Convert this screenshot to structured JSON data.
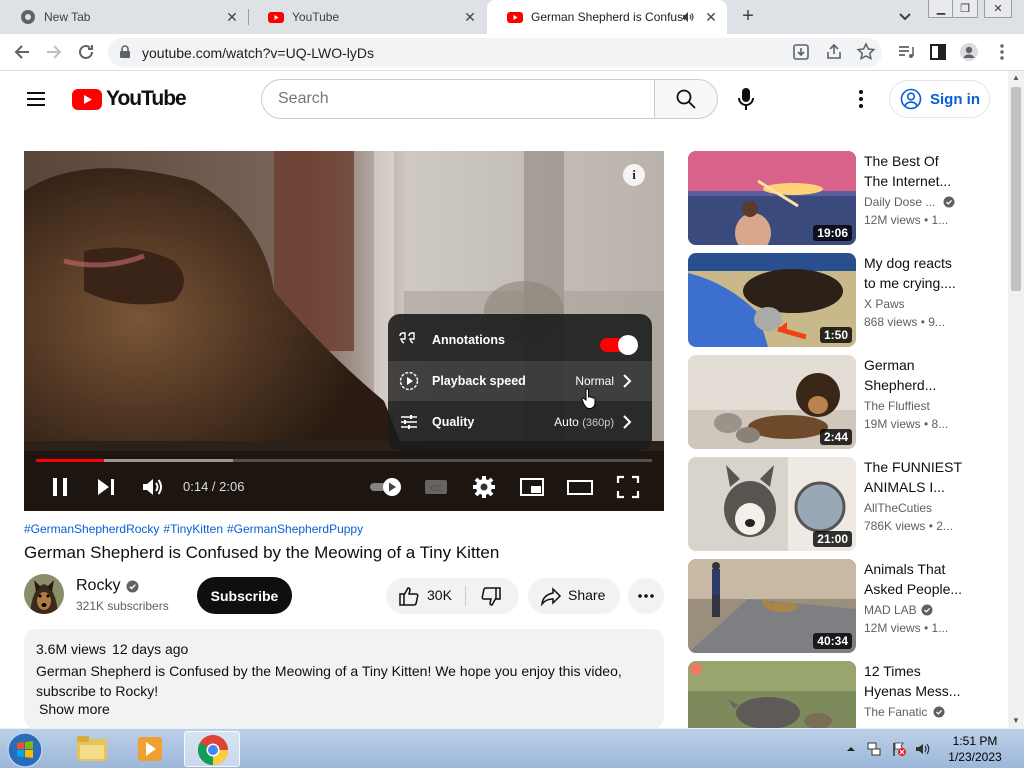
{
  "browser": {
    "tabs": [
      {
        "title": "New Tab"
      },
      {
        "title": "YouTube"
      },
      {
        "title": "German Shepherd is Confuse"
      }
    ],
    "url": "youtube.com/watch?v=UQ-LWO-lyDs"
  },
  "header": {
    "logo_text": "YouTube",
    "search_placeholder": "Search",
    "signin_label": "Sign in"
  },
  "player": {
    "time": "0:14 / 2:06",
    "progress_played": 0.11,
    "progress_loaded": 0.32,
    "settings": [
      {
        "label": "Annotations",
        "value": ""
      },
      {
        "label": "Playback speed",
        "value": "Normal"
      },
      {
        "label": "Quality",
        "value": "Auto",
        "value_sub": "(360p)"
      }
    ],
    "annotations_on": true
  },
  "video": {
    "hashtags": [
      "#GermanShepherdRocky",
      "#TinyKitten",
      "#GermanShepherdPuppy"
    ],
    "title": "German Shepherd is Confused by the Meowing of a Tiny Kitten",
    "channel": "Rocky",
    "subscribers": "321K subscribers",
    "subscribe_label": "Subscribe",
    "likes": "30K",
    "share_label": "Share",
    "views": "3.6M views",
    "age": "12 days ago",
    "description": "German Shepherd is Confused by the Meowing of a Tiny Kitten! We hope you enjoy this video, subscribe to Rocky!",
    "show_more": "Show more"
  },
  "recommendations": [
    {
      "title": "The Best Of The Internet...",
      "channel": "Daily Dose ...",
      "verified": true,
      "stats": "12M views • 1...",
      "duration": "19:06"
    },
    {
      "title": "My dog reacts to me crying....",
      "channel": "X Paws",
      "verified": false,
      "stats": "868 views • 9...",
      "duration": "1:50"
    },
    {
      "title": "German Shepherd...",
      "channel": "The Fluffiest",
      "verified": false,
      "stats": "19M views • 8...",
      "duration": "2:44"
    },
    {
      "title": "The FUNNIEST ANIMALS I...",
      "channel": "AllTheCuties",
      "verified": false,
      "stats": "786K views • 2...",
      "duration": "21:00"
    },
    {
      "title": "Animals That Asked People...",
      "channel": "MAD LAB",
      "verified": true,
      "stats": "12M views • 1...",
      "duration": "40:34"
    },
    {
      "title": "12 Times Hyenas Mess...",
      "channel": "The Fanatic",
      "verified": true,
      "stats": "",
      "duration": ""
    }
  ],
  "taskbar": {
    "time": "1:51 PM",
    "date": "1/23/2023"
  }
}
